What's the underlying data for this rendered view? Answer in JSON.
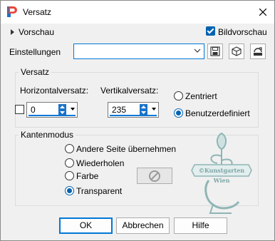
{
  "window": {
    "title": "Versatz"
  },
  "top": {
    "preview_label": "Vorschau",
    "bildvorschau_label": "Bildvorschau",
    "bildvorschau_checked": true
  },
  "presets": {
    "label": "Einstellungen",
    "value": ""
  },
  "offset_group": {
    "title": "Versatz",
    "horizontal_label": "Horizontalversatz:",
    "horizontal_value": "0",
    "vertical_label": "Vertikalversatz:",
    "vertical_value": "235",
    "radio_centered": "Zentriert",
    "radio_custom": "Benutzerdefiniert"
  },
  "edge_group": {
    "title": "Kantenmodus",
    "options": [
      "Andere Seite übernehmen",
      "Wiederholen",
      "Farbe",
      "Transparent"
    ],
    "selected": "Transparent"
  },
  "buttons": {
    "ok": "OK",
    "cancel": "Abbrechen",
    "help": "Hilfe"
  },
  "watermark": {
    "line1": "©Kunstgarten",
    "line2": "Wien"
  },
  "colors": {
    "accent": "#0063b1",
    "focus": "#0078d7",
    "watermark": "#8fb5b5"
  }
}
